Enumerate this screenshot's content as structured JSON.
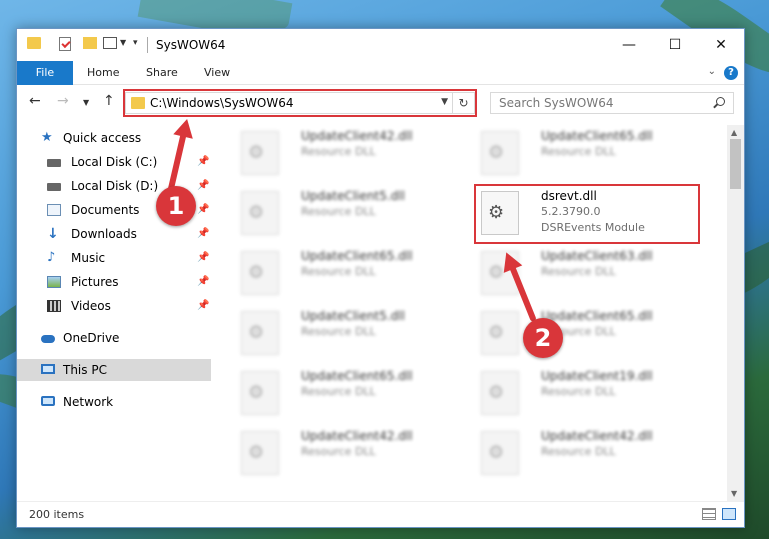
{
  "window": {
    "title": "SysWOW64",
    "controls": {
      "minimize": "—",
      "maximize": "☐",
      "close": "✕"
    }
  },
  "ribbon": {
    "tabs": [
      "File",
      "Home",
      "Share",
      "View"
    ],
    "help": "?"
  },
  "navbar": {
    "address": "C:\\Windows\\SysWOW64",
    "search_placeholder": "Search SysWOW64"
  },
  "sidebar": {
    "items": [
      {
        "label": "Quick access",
        "icon": "star-icon"
      },
      {
        "label": "Local Disk (C:)",
        "icon": "disk-icon",
        "pinned": true
      },
      {
        "label": "Local Disk (D:)",
        "icon": "disk-icon",
        "pinned": true
      },
      {
        "label": "Documents",
        "icon": "documents-icon",
        "pinned": true
      },
      {
        "label": "Downloads",
        "icon": "downloads-icon",
        "pinned": true
      },
      {
        "label": "Music",
        "icon": "music-icon",
        "pinned": true
      },
      {
        "label": "Pictures",
        "icon": "pictures-icon",
        "pinned": true
      },
      {
        "label": "Videos",
        "icon": "videos-icon",
        "pinned": true
      },
      {
        "label": "OneDrive",
        "icon": "onedrive-icon"
      },
      {
        "label": "This PC",
        "icon": "this-pc-icon",
        "selected": true
      },
      {
        "label": "Network",
        "icon": "network-icon"
      }
    ]
  },
  "files": {
    "left_column": [
      {
        "name": "UpdateClient42.dll",
        "desc": "Resource DLL"
      },
      {
        "name": "UpdateClient5.dll",
        "desc": "Resource DLL"
      },
      {
        "name": "UpdateClient65.dll",
        "desc": "Resource DLL"
      },
      {
        "name": "UpdateClient5.dll",
        "desc": "Resource DLL"
      },
      {
        "name": "UpdateClient65.dll",
        "desc": "Resource DLL"
      },
      {
        "name": "UpdateClient42.dll",
        "desc": "Resource DLL"
      }
    ],
    "right_column": [
      {
        "name": "UpdateClient65.dll",
        "desc": "Resource DLL"
      },
      {
        "name": "dsrevt.dll",
        "version": "5.2.3790.0",
        "desc": "DSREvents Module",
        "highlighted": true
      },
      {
        "name": "UpdateClient63.dll",
        "desc": "Resource DLL"
      },
      {
        "name": "UpdateClient65.dll",
        "desc": "Resource DLL"
      },
      {
        "name": "UpdateClient19.dll",
        "desc": "Resource DLL"
      },
      {
        "name": "UpdateClient42.dll",
        "desc": "Resource DLL"
      }
    ]
  },
  "status": {
    "item_count": "200 items"
  },
  "annotations": {
    "badge1": "1",
    "badge2": "2",
    "highlight_color": "#d9363a"
  },
  "colors": {
    "accent": "#1979ca",
    "selected_bg": "#d9d9d9"
  }
}
